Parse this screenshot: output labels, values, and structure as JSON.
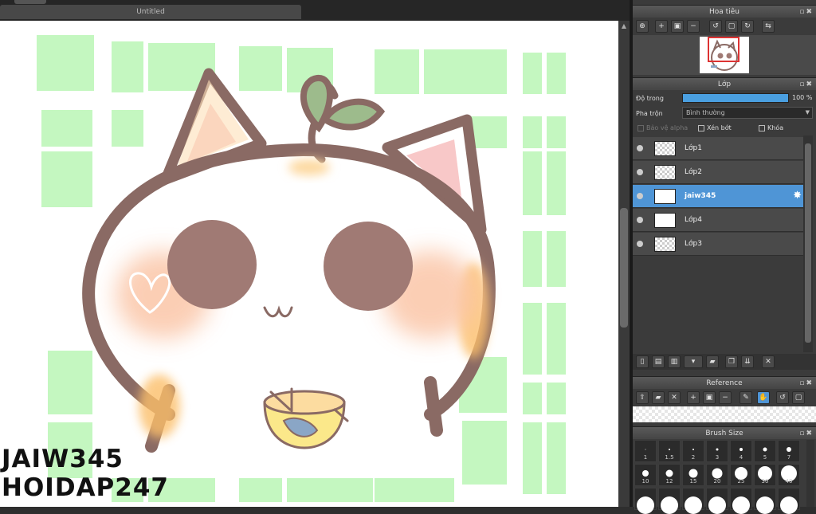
{
  "document": {
    "title": "Untitled"
  },
  "watermark": {
    "line1": "JAIW345",
    "line2": "HOIDAP247"
  },
  "navigator": {
    "title": "Hoa tiêu"
  },
  "layer_panel": {
    "title": "Lớp",
    "opacity_label": "Độ trong",
    "opacity_value": "100 %",
    "opacity": 1.0,
    "blend_label": "Pha trộn",
    "blend_value": "Bình thường",
    "protect_alpha": "Bảo vệ alpha",
    "clipping": "Xén bớt",
    "lock": "Khóa",
    "layers": [
      {
        "name": "Lớp1",
        "selected": false
      },
      {
        "name": "Lớp2",
        "selected": false
      },
      {
        "name": "jaiw345",
        "selected": true
      },
      {
        "name": "Lớp4",
        "selected": false
      },
      {
        "name": "Lớp3",
        "selected": false
      }
    ]
  },
  "reference": {
    "title": "Reference"
  },
  "brush_size": {
    "title": "Brush Size",
    "row1": [
      "1",
      "1.5",
      "2",
      "3",
      "4",
      "5",
      "7"
    ],
    "row2": [
      "10",
      "12",
      "15",
      "20",
      "25",
      "30",
      "40"
    ]
  },
  "colors": {
    "accent": "#4f95d6",
    "grid_green": "#c4f7c0",
    "outline": "#8a6a64"
  },
  "icons": {
    "window": "▫",
    "close": "✖",
    "gear": "✸"
  }
}
